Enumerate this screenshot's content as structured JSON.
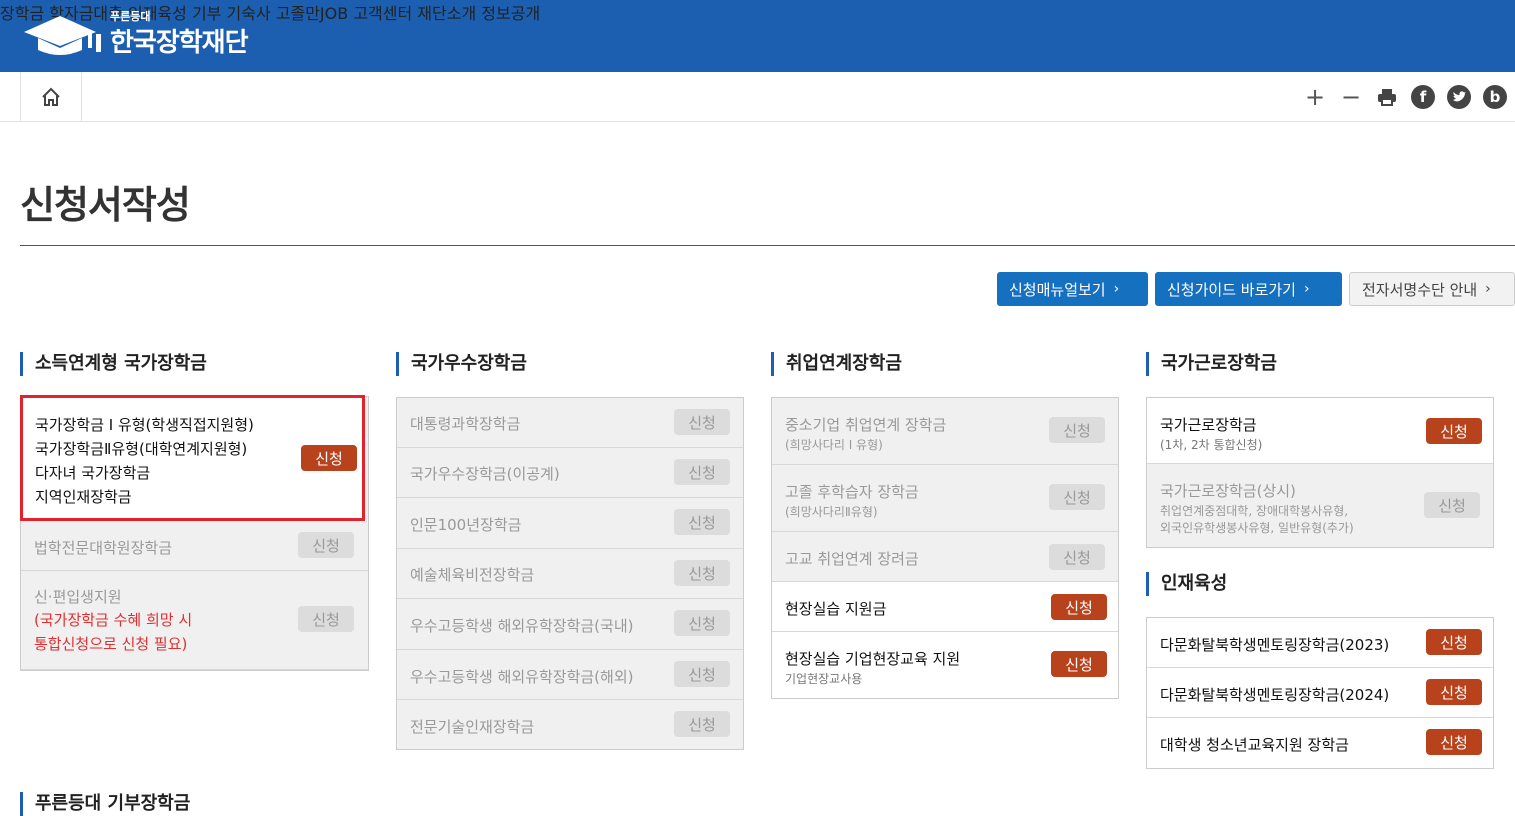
{
  "header": {
    "logo_sub": "푸른등대",
    "logo_main": "한국장학재단",
    "nav": [
      "장학금",
      "학자금대출",
      "인재육성",
      "기부",
      "기숙사",
      "고졸만JOB",
      "고객센터",
      "재단소개",
      "정보공개"
    ]
  },
  "toolbar": {
    "icons": [
      "home-icon",
      "zoom-in-icon",
      "zoom-out-icon",
      "print-icon",
      "facebook-icon",
      "twitter-icon",
      "blog-icon"
    ],
    "zoom_in": "+",
    "zoom_out": "−",
    "facebook": "f",
    "blog": "b"
  },
  "page_title": "신청서작성",
  "top_buttons": [
    {
      "label": "신청매뉴얼보기"
    },
    {
      "label": "신청가이드 바로가기"
    },
    {
      "label": "전자서명수단 안내"
    }
  ],
  "col1": {
    "title": "소득연계형 국가장학금",
    "highlight": [
      "국가장학금 Ⅰ 유형(학생직접지원형)",
      "국가장학금Ⅱ유형(대학연계지원형)",
      "다자녀 국가장학금",
      "지역인재장학금"
    ],
    "highlight_apply": "신청",
    "items": [
      {
        "name": "법학전문대학원장학금",
        "apply": "신청"
      },
      {
        "name": "신·편입생지원",
        "note1": "(국가장학금 수혜 희망 시",
        "note2": "통합신청으로 신청 필요)",
        "apply": "신청"
      }
    ]
  },
  "col2": {
    "title": "국가우수장학금",
    "items": [
      {
        "name": "대통령과학장학금",
        "apply": "신청"
      },
      {
        "name": "국가우수장학금(이공계)",
        "apply": "신청"
      },
      {
        "name": "인문100년장학금",
        "apply": "신청"
      },
      {
        "name": "예술체육비전장학금",
        "apply": "신청"
      },
      {
        "name": "우수고등학생 해외유학장학금(국내)",
        "apply": "신청"
      },
      {
        "name": "우수고등학생 해외유학장학금(해외)",
        "apply": "신청"
      },
      {
        "name": "전문기술인재장학금",
        "apply": "신청"
      }
    ]
  },
  "col3": {
    "title": "취업연계장학금",
    "items": [
      {
        "name": "중소기업 취업연계 장학금",
        "sub": "(희망사다리 Ⅰ 유형)",
        "apply": "신청"
      },
      {
        "name": "고졸 후학습자 장학금",
        "sub": "(희망사다리Ⅱ유형)",
        "apply": "신청"
      },
      {
        "name": "고교 취업연계 장려금",
        "apply": "신청"
      },
      {
        "name": "현장실습 지원금",
        "apply": "신청"
      },
      {
        "name": "현장실습 기업현장교육 지원",
        "sub": "기업현장교사용",
        "apply": "신청"
      }
    ]
  },
  "col4": {
    "title": "국가근로장학금",
    "items": [
      {
        "name": "국가근로장학금",
        "sub": "(1차, 2차 통합신청)",
        "apply": "신청"
      },
      {
        "name": "국가근로장학금(상시)",
        "sub1": "취업연계중점대학, 장애대학봉사유형,",
        "sub2": "외국인유학생봉사유형, 일반유형(추가)",
        "apply": "신청"
      }
    ],
    "title2": "인재육성",
    "items2": [
      {
        "name": "다문화탈북학생멘토링장학금(2023)",
        "apply": "신청"
      },
      {
        "name": "다문화탈북학생멘토링장학금(2024)",
        "apply": "신청"
      },
      {
        "name": "대학생 청소년교육지원 장학금",
        "apply": "신청"
      }
    ]
  },
  "bottom_title": "푸른등대 기부장학금",
  "colors": {
    "header_bg": "#1c5fb0",
    "apply_active": "#b8421c",
    "highlight_border": "#e0232e",
    "button_blue": "#1670c0"
  }
}
